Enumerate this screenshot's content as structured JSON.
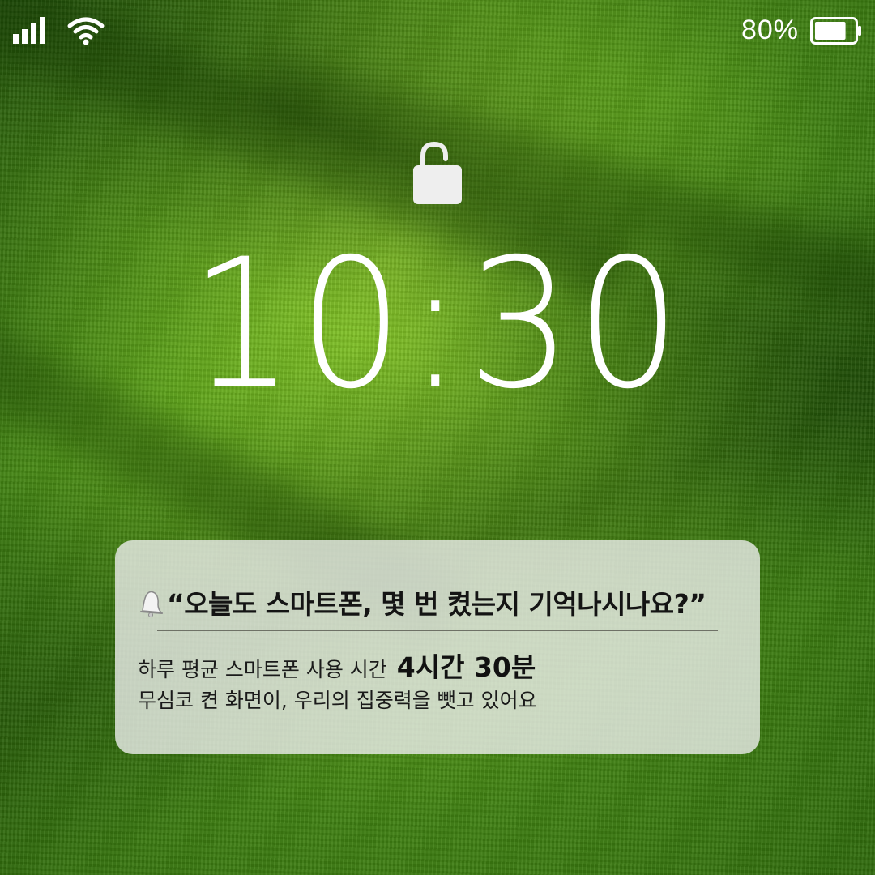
{
  "status_bar": {
    "signal_icon": "cellular-signal-icon",
    "wifi_icon": "wifi-icon",
    "battery_percent": "80%",
    "battery_icon": "battery-icon",
    "battery_level": 0.8
  },
  "lock_screen": {
    "lock_icon": "unlocked-padlock-icon",
    "time": "10:30"
  },
  "notification": {
    "icon": "bell-icon",
    "title": "“오늘도 스마트폰, 몇 번 켰는지 기억나시나요?”",
    "line1_text": "하루 평균 스마트폰 사용 시간",
    "line1_highlight": "4시간 30분",
    "line2_text": "무심코 켠 화면이, 우리의 집중력을 뺏고 있어요"
  }
}
